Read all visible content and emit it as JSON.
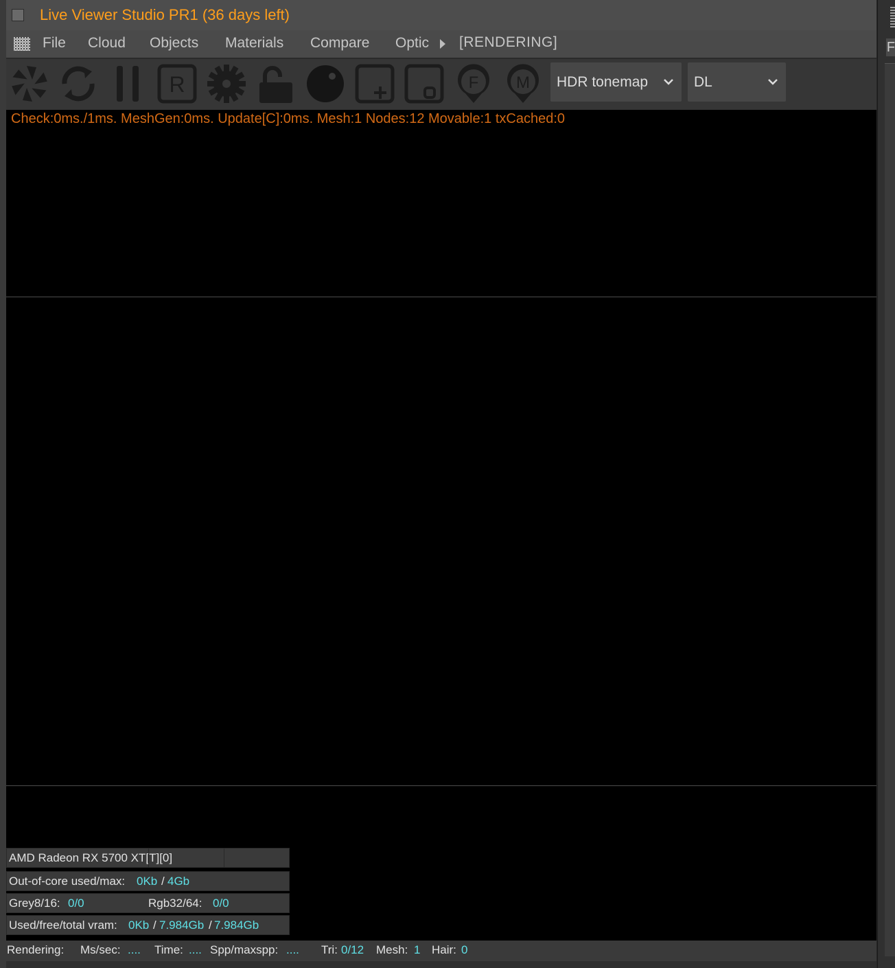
{
  "window": {
    "title": "Live Viewer Studio PR1 (36 days left)"
  },
  "menu": {
    "items": [
      "File",
      "Cloud",
      "Objects",
      "Materials",
      "Compare",
      "Optic"
    ],
    "status": "[RENDERING]"
  },
  "toolbar": {
    "icons": [
      "aperture-icon",
      "refresh-icon",
      "pause-icon",
      "region-icon",
      "gear-icon",
      "unlock-icon",
      "sphere-icon",
      "add-region-icon",
      "focus-region-icon",
      "focus-pin-icon",
      "material-pin-icon"
    ],
    "tonemap_select": "HDR tonemap",
    "kernel_select": "DL"
  },
  "info": "Check:0ms./1ms. MeshGen:0ms. Update[C]:0ms. Mesh:1 Nodes:12 Movable:1 txCached:0",
  "stats": {
    "gpu": "AMD Radeon RX 5700 XT[T][0]",
    "out_of_core_label": "Out-of-core used/max:",
    "out_of_core_used": "0Kb",
    "out_of_core_max": "4Gb",
    "grey_label": "Grey8/16:",
    "grey_value": "0/0",
    "rgb_label": "Rgb32/64:",
    "rgb_value": "0/0",
    "vram_label": "Used/free/total vram:",
    "vram_used": "0Kb",
    "vram_free": "7.984Gb",
    "vram_total": "7.984Gb",
    "slash": "/"
  },
  "status": {
    "rendering_label": "Rendering:",
    "ms_label": "Ms/sec:",
    "ms_value": "....",
    "time_label": "Time:",
    "time_value": "....",
    "spp_label": "Spp/maxspp:",
    "spp_value": "....",
    "tri_label": "Tri:",
    "tri_value": "0/12",
    "mesh_label": "Mesh:",
    "mesh_value": "1",
    "hair_label": "Hair:",
    "hair_value": "0"
  },
  "side_panel": {
    "letter": "F"
  },
  "colors": {
    "title": "#ff9e1b",
    "info": "#d36a16",
    "value": "#5fe0e6",
    "icon": "#1c1c1c"
  }
}
